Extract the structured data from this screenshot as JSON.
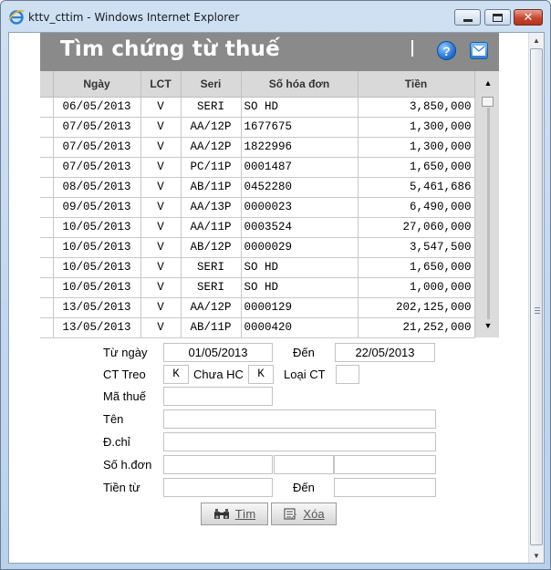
{
  "window": {
    "title": "kttv_cttim - Windows Internet Explorer"
  },
  "header": {
    "title": "Tìm chứng từ thuế",
    "help_icon": "help-icon",
    "mail_icon": "mail-icon"
  },
  "grid": {
    "columns": [
      "Ngày",
      "LCT",
      "Seri",
      "Số hóa đơn",
      "Tiền"
    ],
    "rows": [
      {
        "ngay": "06/05/2013",
        "lct": "V",
        "seri": "SERI",
        "so": "SO HD",
        "tien": "3,850,000"
      },
      {
        "ngay": "07/05/2013",
        "lct": "V",
        "seri": "AA/12P",
        "so": "1677675",
        "tien": "1,300,000"
      },
      {
        "ngay": "07/05/2013",
        "lct": "V",
        "seri": "AA/12P",
        "so": "1822996",
        "tien": "1,300,000"
      },
      {
        "ngay": "07/05/2013",
        "lct": "V",
        "seri": "PC/11P",
        "so": "0001487",
        "tien": "1,650,000"
      },
      {
        "ngay": "08/05/2013",
        "lct": "V",
        "seri": "AB/11P",
        "so": "0452280",
        "tien": "5,461,686"
      },
      {
        "ngay": "09/05/2013",
        "lct": "V",
        "seri": "AA/13P",
        "so": "0000023",
        "tien": "6,490,000"
      },
      {
        "ngay": "10/05/2013",
        "lct": "V",
        "seri": "AA/11P",
        "so": "0003524",
        "tien": "27,060,000"
      },
      {
        "ngay": "10/05/2013",
        "lct": "V",
        "seri": "AB/12P",
        "so": "0000029",
        "tien": "3,547,500"
      },
      {
        "ngay": "10/05/2013",
        "lct": "V",
        "seri": "SERI",
        "so": "SO HD",
        "tien": "1,650,000"
      },
      {
        "ngay": "10/05/2013",
        "lct": "V",
        "seri": "SERI",
        "so": "SO HD",
        "tien": "1,000,000"
      },
      {
        "ngay": "13/05/2013",
        "lct": "V",
        "seri": "AA/12P",
        "so": "0000129",
        "tien": "202,125,000"
      },
      {
        "ngay": "13/05/2013",
        "lct": "V",
        "seri": "AB/11P",
        "so": "0000420",
        "tien": "21,252,000"
      }
    ]
  },
  "form": {
    "tu_ngay_label": "Từ ngày",
    "tu_ngay_value": "01/05/2013",
    "den_label": "Đến",
    "den_value": "22/05/2013",
    "ct_treo_label": "CT Treo",
    "ct_treo_value": "K",
    "chua_hc_label": "Chưa HC",
    "chua_hc_value": "K",
    "loai_ct_label": "Loại CT",
    "loai_ct_value": "",
    "ma_thue_label": "Mã thuế",
    "ma_thue_value": "",
    "ten_label": "Tên",
    "ten_value": "",
    "dchi_label": "Đ.chỉ",
    "dchi_value": "",
    "so_hdon_label": "Số h.đơn",
    "so_hdon_value_1": "",
    "so_hdon_value_2": "",
    "so_hdon_value_3": "",
    "tien_tu_label": "Tiền từ",
    "tien_tu_value": "",
    "tien_den_label": "Đến",
    "tien_den_value": ""
  },
  "buttons": {
    "tim_label": "Tìm",
    "xoa_label": "Xóa"
  }
}
